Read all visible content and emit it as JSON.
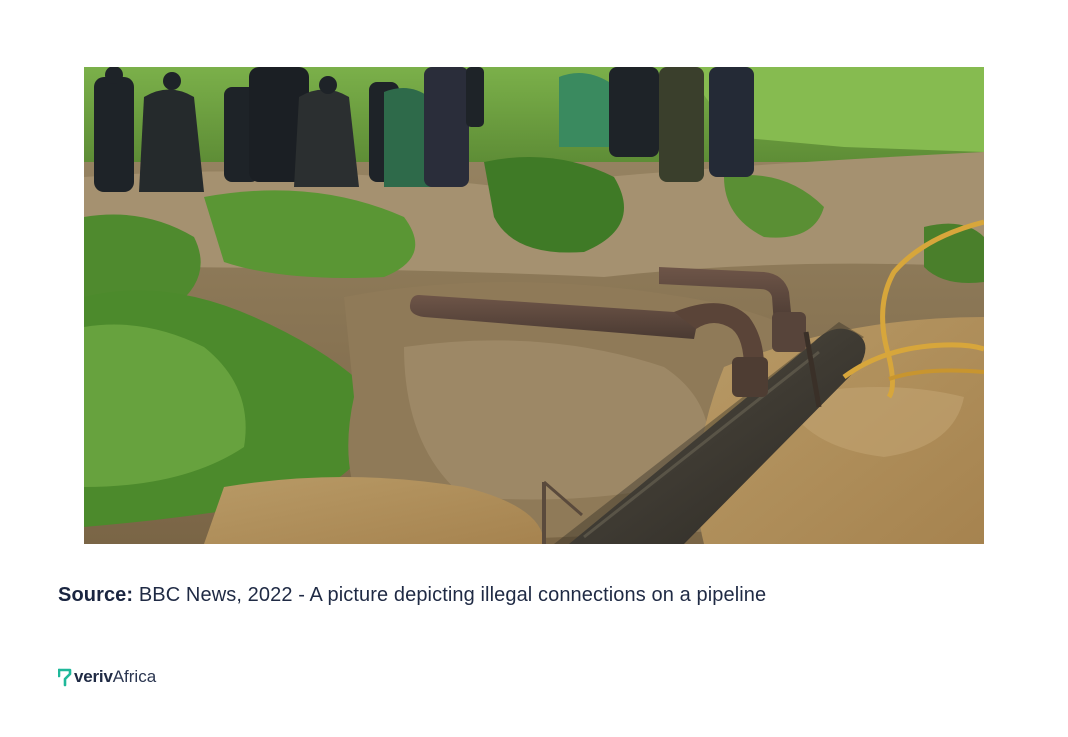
{
  "caption": {
    "label": "Source:",
    "text": "BBC News, 2022 - A picture depicting illegal connections on a pipeline"
  },
  "logo": {
    "brand_bold": "veriv",
    "brand_light": "Africa",
    "mark_color": "#1fb89a"
  },
  "photo": {
    "subject": "illegal connections on a pipeline"
  }
}
